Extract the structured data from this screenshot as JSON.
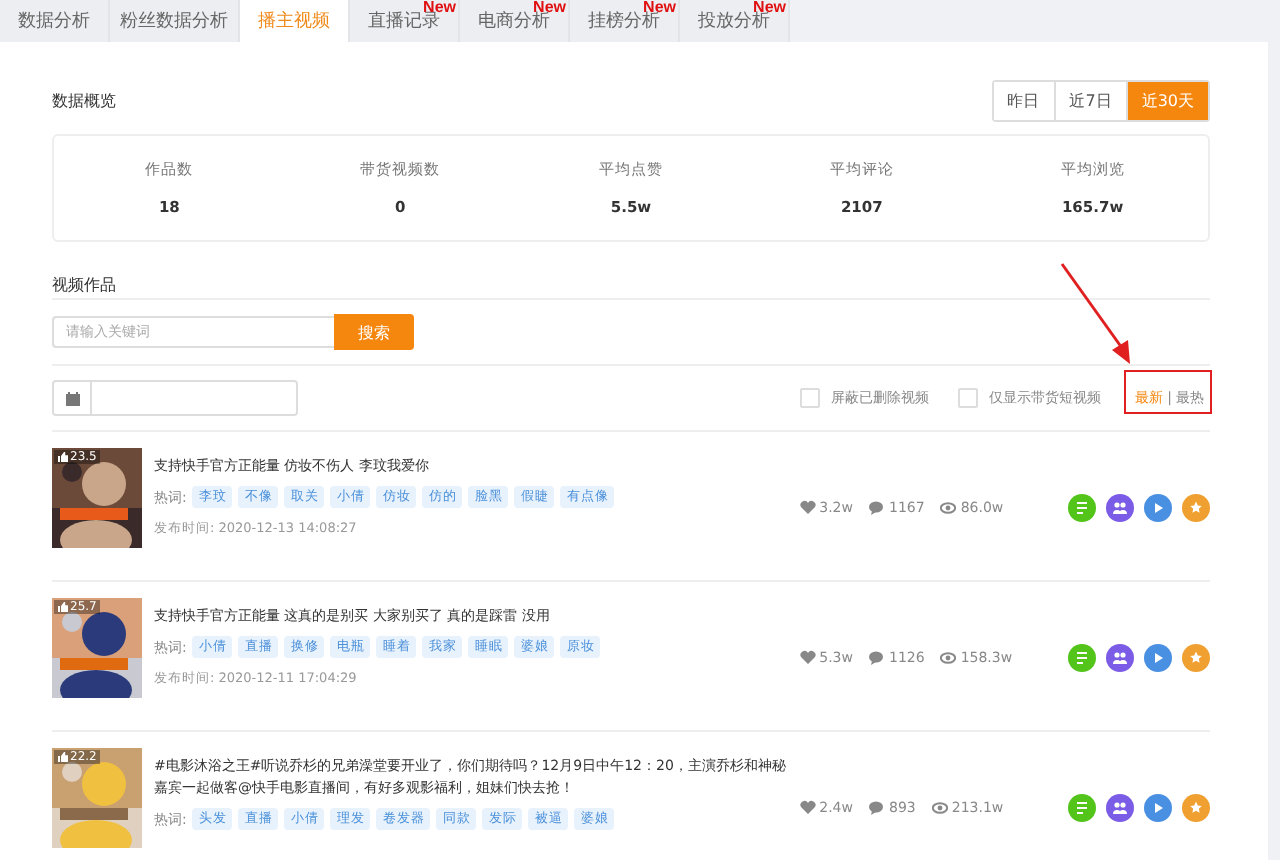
{
  "tabs": [
    {
      "label": "数据分析",
      "selected": false
    },
    {
      "label": "粉丝数据分析",
      "selected": false
    },
    {
      "label": "播主视频",
      "selected": true
    },
    {
      "label": "直播记录",
      "selected": false,
      "badge": "New"
    },
    {
      "label": "电商分析",
      "selected": false,
      "badge": "New"
    },
    {
      "label": "挂榜分析",
      "selected": false,
      "badge": "New"
    },
    {
      "label": "投放分析",
      "selected": false,
      "badge": "New"
    }
  ],
  "overview": {
    "title": "数据概览",
    "ranges": [
      {
        "label": "昨日",
        "selected": false
      },
      {
        "label": "近7日",
        "selected": false
      },
      {
        "label": "近30天",
        "selected": true
      }
    ],
    "stats": [
      {
        "label": "作品数",
        "value": "18"
      },
      {
        "label": "带货视频数",
        "value": "0"
      },
      {
        "label": "平均点赞",
        "value": "5.5w"
      },
      {
        "label": "平均评论",
        "value": "2107"
      },
      {
        "label": "平均浏览",
        "value": "165.7w"
      }
    ]
  },
  "videos": {
    "title": "视频作品",
    "search": {
      "placeholder": "请输入关键词",
      "button": "搜索"
    },
    "filters": [
      {
        "label": "屏蔽已删除视频",
        "checked": false
      },
      {
        "label": "仅显示带货短视频",
        "checked": false
      }
    ],
    "sort": [
      {
        "label": "最新",
        "selected": true
      },
      {
        "label": "最热",
        "selected": false
      }
    ],
    "sort_separator": "|",
    "items": [
      {
        "likes_badge": "23.5",
        "title": "支持快手官方正能量 仿妆不伤人 李玟我爱你",
        "tags_label": "热词:",
        "tags": [
          "李玟",
          "不像",
          "取关",
          "小倩",
          "仿妆",
          "仿的",
          "脸黑",
          "假睫",
          "有点像"
        ],
        "published": "发布时间: 2020-12-13 14:08:27",
        "likes": "3.2w",
        "comments": "1167",
        "views": "86.0w"
      },
      {
        "likes_badge": "25.7",
        "title": "支持快手官方正能量 这真的是别买 大家别买了 真的是踩雷 没用",
        "tags_label": "热词:",
        "tags": [
          "小倩",
          "直播",
          "换修",
          "电瓶",
          "睡着",
          "我家",
          "睡眠",
          "婆娘",
          "原妆"
        ],
        "published": "发布时间: 2020-12-11 17:04:29",
        "likes": "5.3w",
        "comments": "1126",
        "views": "158.3w"
      },
      {
        "likes_badge": "22.2",
        "title": "#电影沐浴之王#听说乔杉的兄弟澡堂要开业了，你们期待吗？12月9日中午12：20，主演乔杉和神秘嘉宾一起做客@快手电影直播间，有好多观影福利，姐妹们快去抢！",
        "tags_label": "热词:",
        "tags": [
          "头发",
          "直播",
          "小倩",
          "理发",
          "卷发器",
          "同款",
          "发际",
          "被逼",
          "婆娘"
        ],
        "likes": "2.4w",
        "comments": "893",
        "views": "213.1w"
      }
    ]
  }
}
